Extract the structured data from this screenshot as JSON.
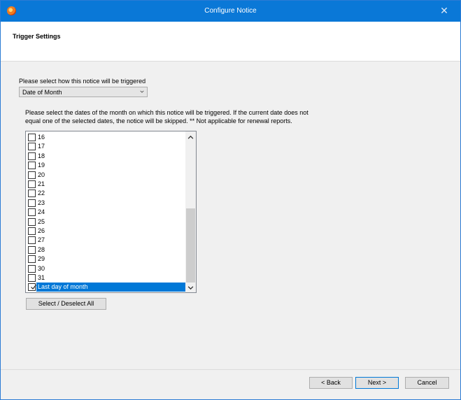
{
  "window": {
    "title": "Configure Notice",
    "close_glyph": "✕"
  },
  "header": {
    "heading": "Trigger Settings"
  },
  "trigger": {
    "label": "Please select how this notice will be triggered",
    "selected_value": "Date of Month"
  },
  "description": {
    "line1": "Please select the dates of the month on which this notice will be triggered. If the current date does not",
    "line2": "equal one of the selected dates, the notice will be skipped.  ** Not applicable for renewal reports."
  },
  "dates_list": {
    "items": [
      {
        "label": "16",
        "checked": false
      },
      {
        "label": "17",
        "checked": false
      },
      {
        "label": "18",
        "checked": false
      },
      {
        "label": "19",
        "checked": false
      },
      {
        "label": "20",
        "checked": false
      },
      {
        "label": "21",
        "checked": false
      },
      {
        "label": "22",
        "checked": false
      },
      {
        "label": "23",
        "checked": false
      },
      {
        "label": "24",
        "checked": false
      },
      {
        "label": "25",
        "checked": false
      },
      {
        "label": "26",
        "checked": false
      },
      {
        "label": "27",
        "checked": false
      },
      {
        "label": "28",
        "checked": false
      },
      {
        "label": "29",
        "checked": false
      },
      {
        "label": "30",
        "checked": false
      },
      {
        "label": "31",
        "checked": false
      },
      {
        "label": "Last day of month",
        "checked": true
      }
    ],
    "selected_index": 16
  },
  "buttons": {
    "select_all": "Select / Deselect All",
    "back": "< Back",
    "next": "Next >",
    "cancel": "Cancel"
  },
  "colors": {
    "titlebar": "#0a78d7",
    "selection": "#0078d7"
  },
  "icons": {
    "app": "app-logo-icon",
    "close": "close-icon",
    "dropdown": "chevron-down-icon",
    "scroll_up": "scroll-up-icon",
    "scroll_down": "scroll-down-icon",
    "check": "checkmark-icon"
  }
}
